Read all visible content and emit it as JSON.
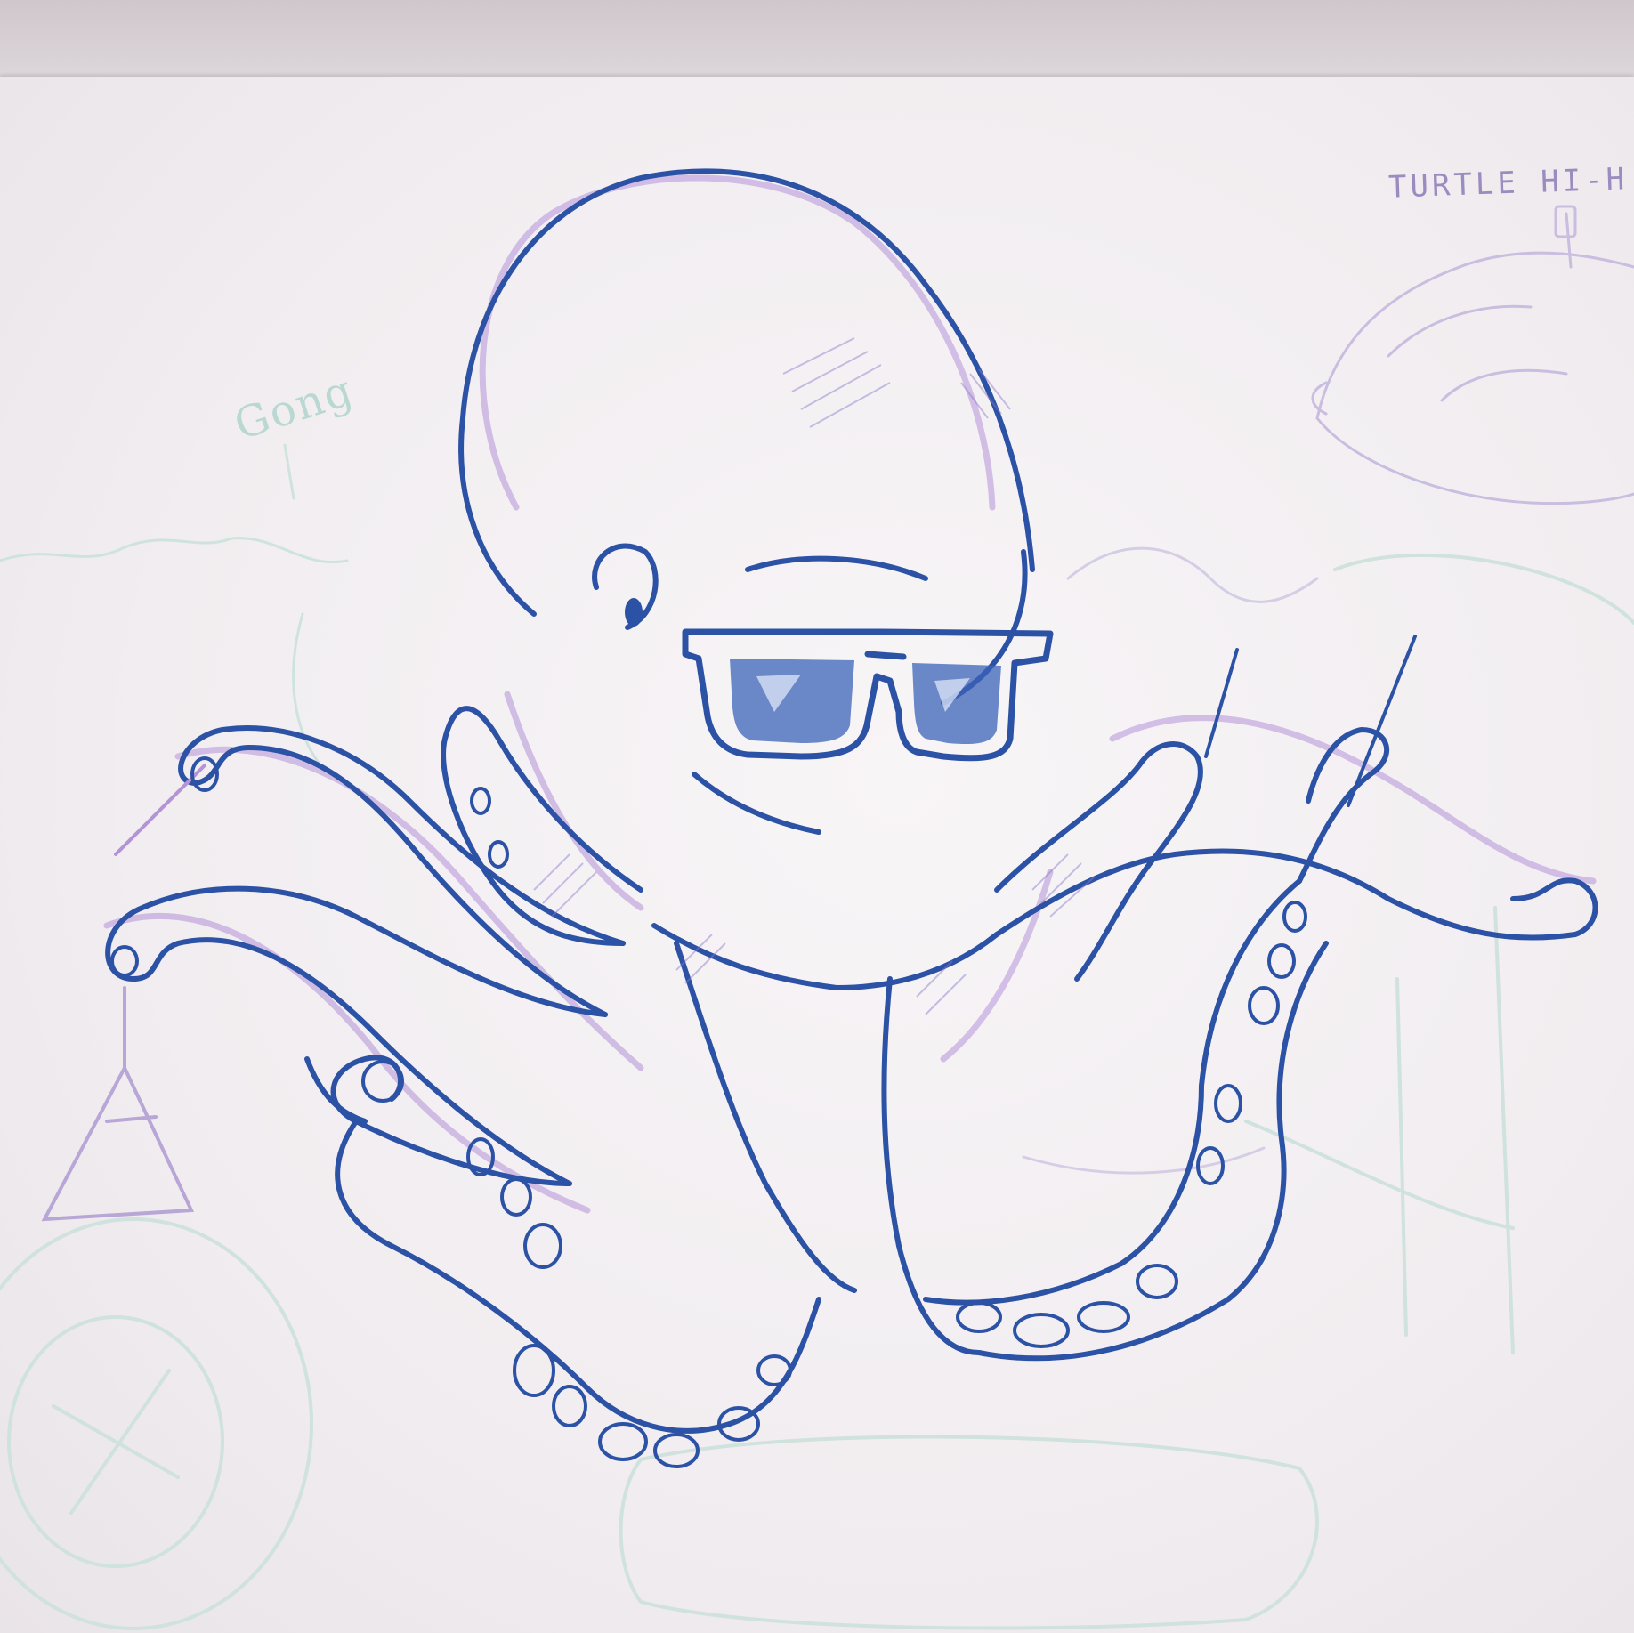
{
  "sketch": {
    "notes": {
      "turtle_hihat": "TURTLE HI-H",
      "gong": "Gong"
    },
    "colors": {
      "outline_blue": "#2c52a6",
      "pencil_purple": "#9a6cc8",
      "sketch_teal": "#b9dbd5",
      "sketch_lavender": "#c9bde0",
      "paper": "#f4f0f3"
    }
  }
}
